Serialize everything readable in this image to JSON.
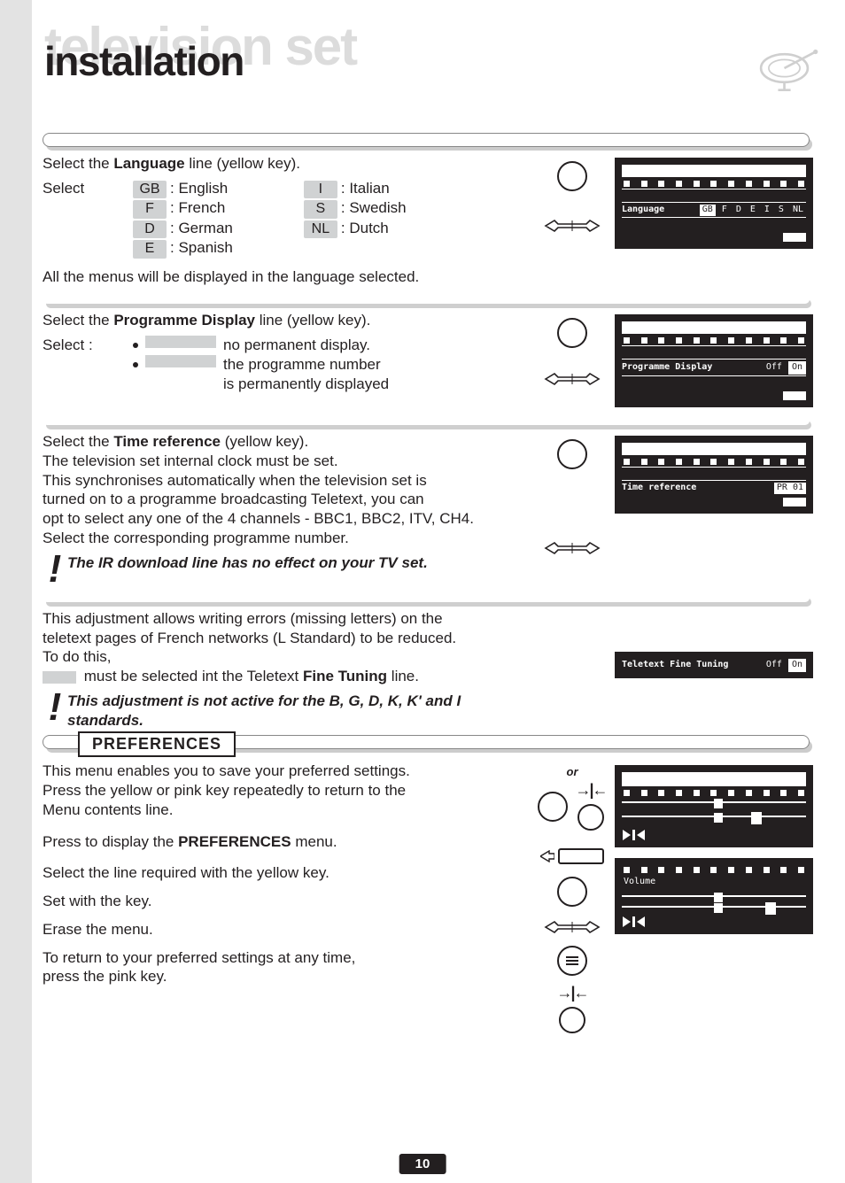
{
  "header": {
    "bg_title": "television set",
    "fg_title": "installation"
  },
  "section_language": {
    "line1_pre": "Select the ",
    "line1_bold": "Language",
    "line1_post": " line (yellow key).",
    "select_label": "Select",
    "langs_left": [
      {
        "code": "GB",
        "name": ": English"
      },
      {
        "code": "F",
        "name": ": French"
      },
      {
        "code": "D",
        "name": ": German"
      },
      {
        "code": "E",
        "name": ": Spanish"
      }
    ],
    "langs_right": [
      {
        "code": "I",
        "name": ": Italian"
      },
      {
        "code": "S",
        "name": ": Swedish"
      },
      {
        "code": "NL",
        "name": ": Dutch"
      }
    ],
    "footer": "All the menus will be displayed in the language selected.",
    "osd": {
      "label": "Language",
      "opts": [
        "GB",
        "F",
        "D",
        "E",
        "I",
        "S",
        "NL"
      ],
      "selected": 0
    }
  },
  "section_progdisp": {
    "line1_pre": "Select the ",
    "line1_bold": "Programme Display",
    "line1_post": " line (yellow key).",
    "select_label": "Select :",
    "opt1": "no permanent display.",
    "opt2a": "the programme number",
    "opt2b": "is permanently displayed",
    "osd": {
      "label": "Programme Display",
      "opts": [
        "Off",
        "On"
      ],
      "selected": 1
    }
  },
  "section_timeref": {
    "line1_pre": "Select the ",
    "line1_bold": "Time reference",
    "line1_post": " (yellow key).",
    "l2": "The television set internal clock must be set.",
    "l3": "This synchronises automatically when the television set is",
    "l4": "turned on to a programme broadcasting Teletext, you can",
    "l5": "opt to select any one of the 4 channels - BBC1, BBC2, ITV, CH4.",
    "l6": "Select the corresponding programme number.",
    "note": "The IR download line has no effect on your TV set.",
    "osd": {
      "label": "Time reference",
      "val": "PR 01"
    }
  },
  "section_ttx": {
    "l1": "This adjustment allows writing errors (missing letters) on the",
    "l2": "teletext pages of French networks (L Standard) to be reduced.",
    "l3": "To do this,",
    "l4_post": " must be selected int the Teletext ",
    "l4_bold": "Fine Tuning",
    "l4_end": " line.",
    "note_pre": "This adjustment is not active for the B, G, D, K, K' and I",
    "note_post": "standards.",
    "osd": {
      "label": "Teletext Fine Tuning",
      "opts": [
        "Off",
        "On"
      ],
      "selected": 1
    }
  },
  "preferences": {
    "heading": "PREFERENCES",
    "p1a": "This menu enables you to save your preferred settings.",
    "p1b": "Press the yellow or pink key repeatedly to return to the",
    "p1c": "Menu contents line.",
    "p2_pre": "Press to display the ",
    "p2_bold": "PREFERENCES",
    "p2_post": " menu.",
    "p3": "Select the line required with the yellow key.",
    "p4": "Set with the key.",
    "p5": "Erase the menu.",
    "p6": "To return to your preferred settings at any time,",
    "p7": "press the pink key.",
    "or": "or",
    "osd_volume": "Volume"
  },
  "page_number": "10"
}
